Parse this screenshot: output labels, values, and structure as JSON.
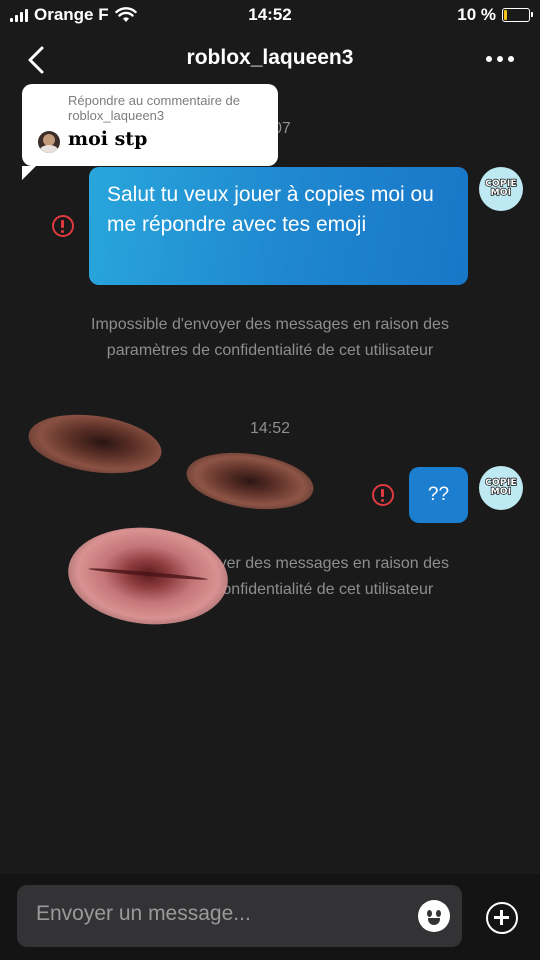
{
  "status_bar": {
    "carrier": "Orange F",
    "time": "14:52",
    "battery_percent": "10 %",
    "battery_level": 0.1,
    "battery_color": "#f2c21b"
  },
  "header": {
    "title": "roblox_laqueen3",
    "back_icon": "chevron-left-icon",
    "more_icon": "more-horizontal-icon"
  },
  "reply_card": {
    "heading": "Répondre au commentaire de roblox_laqueen3",
    "comment": "moi stp"
  },
  "timestamp_top_partial": "07",
  "messages": [
    {
      "text": "Salut tu veux jouer à copies moi ou me répondre avec tes emoji",
      "status_icon": "error-icon",
      "avatar_text": [
        "COPIE",
        "MOI"
      ]
    },
    {
      "text": "??",
      "status_icon": "error-icon",
      "avatar_text": [
        "COPIE",
        "MOI"
      ]
    }
  ],
  "system_messages": [
    "Impossible d'envoyer des messages en raison des paramètres de confidentialité de cet utilisateur",
    "Impossible d'envoyer des messages en raison des paramètres de confidentialité de cet utilisateur"
  ],
  "timestamp_middle": "14:52",
  "input": {
    "placeholder": "Envoyer un message..."
  },
  "colors": {
    "background": "#1a1a1b",
    "bubble": "#1e86cf",
    "error": "#e0393e",
    "muted_text": "#8e8e8e"
  }
}
